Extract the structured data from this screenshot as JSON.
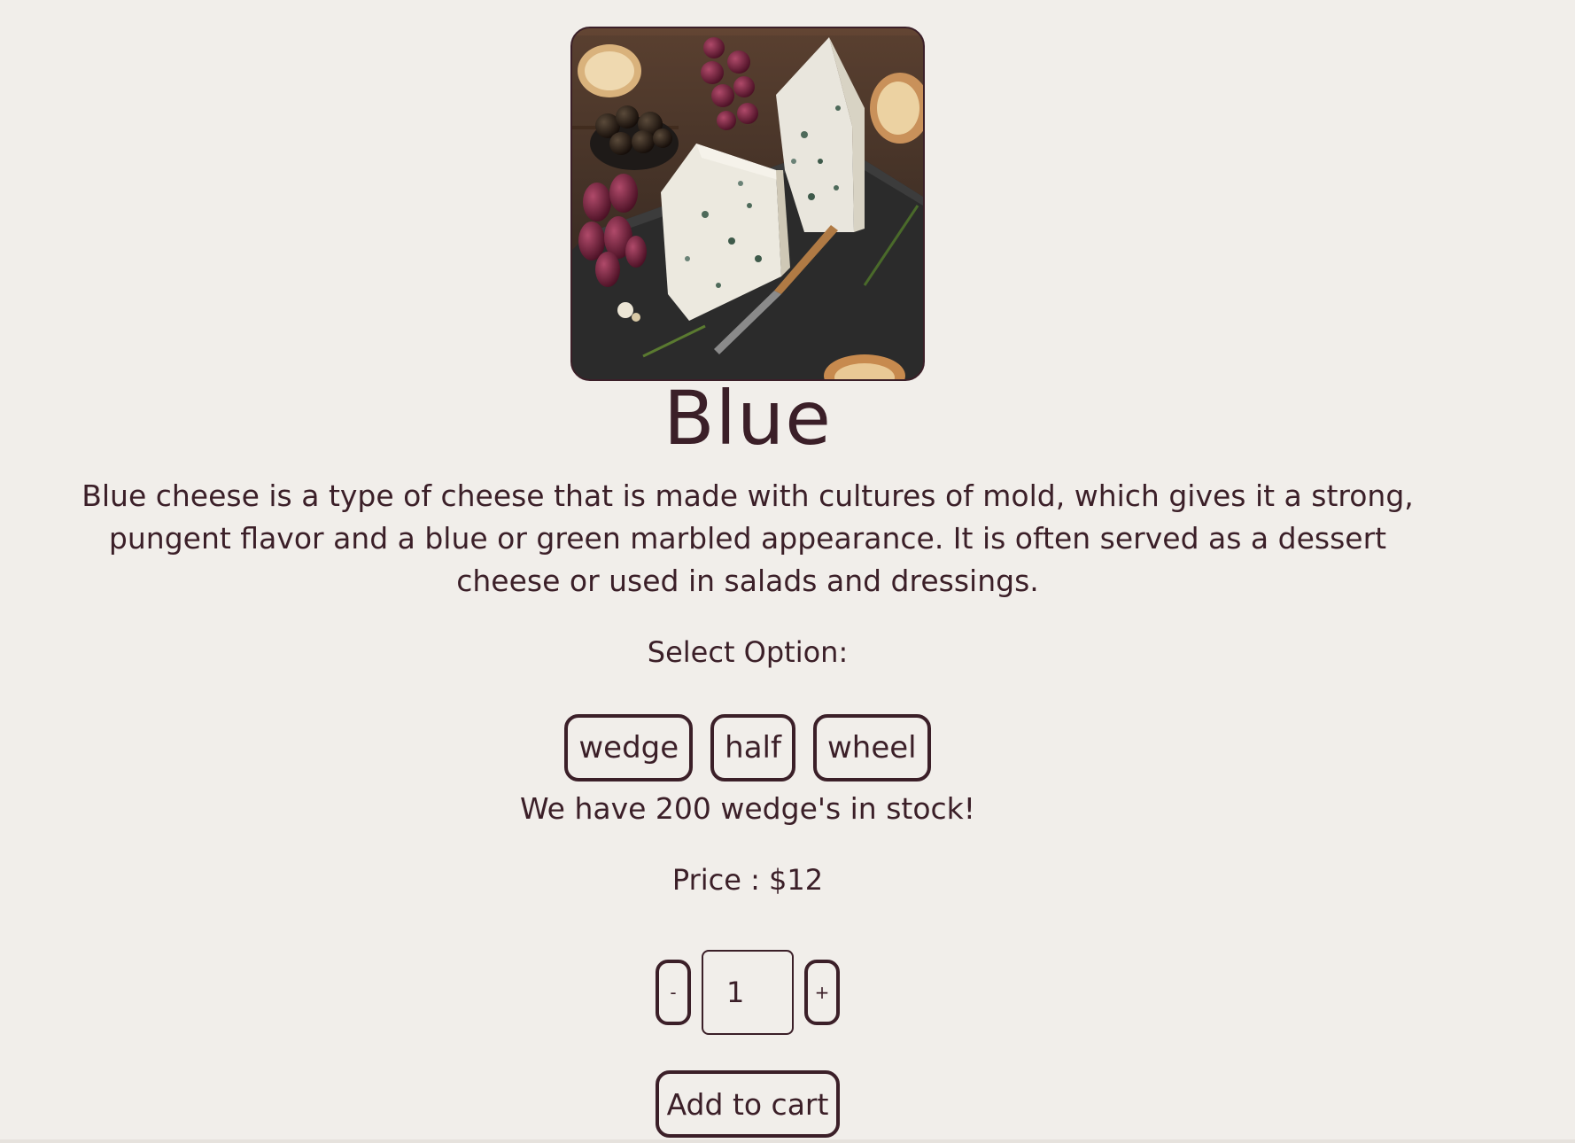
{
  "product": {
    "image_alt": "Blue cheese wedges on a slate board with grapes, olives, bread and a knife",
    "title": "Blue",
    "description": "Blue cheese is a type of cheese that is made with cultures of mold, which gives it a strong, pungent flavor and a blue or green marbled appearance. It is often served as a dessert cheese or used in salads and dressings.",
    "select_label": "Select Option:",
    "options": [
      "wedge",
      "half",
      "wheel"
    ],
    "selected_option": "wedge",
    "stock_text": "We have 200 wedge's in stock!",
    "price_text": "Price : $12",
    "quantity": {
      "decrement_label": "-",
      "value": "1",
      "increment_label": "+"
    },
    "add_to_cart_label": "Add to cart"
  },
  "colors": {
    "background": "#f1eeea",
    "text": "#3b1f28"
  }
}
